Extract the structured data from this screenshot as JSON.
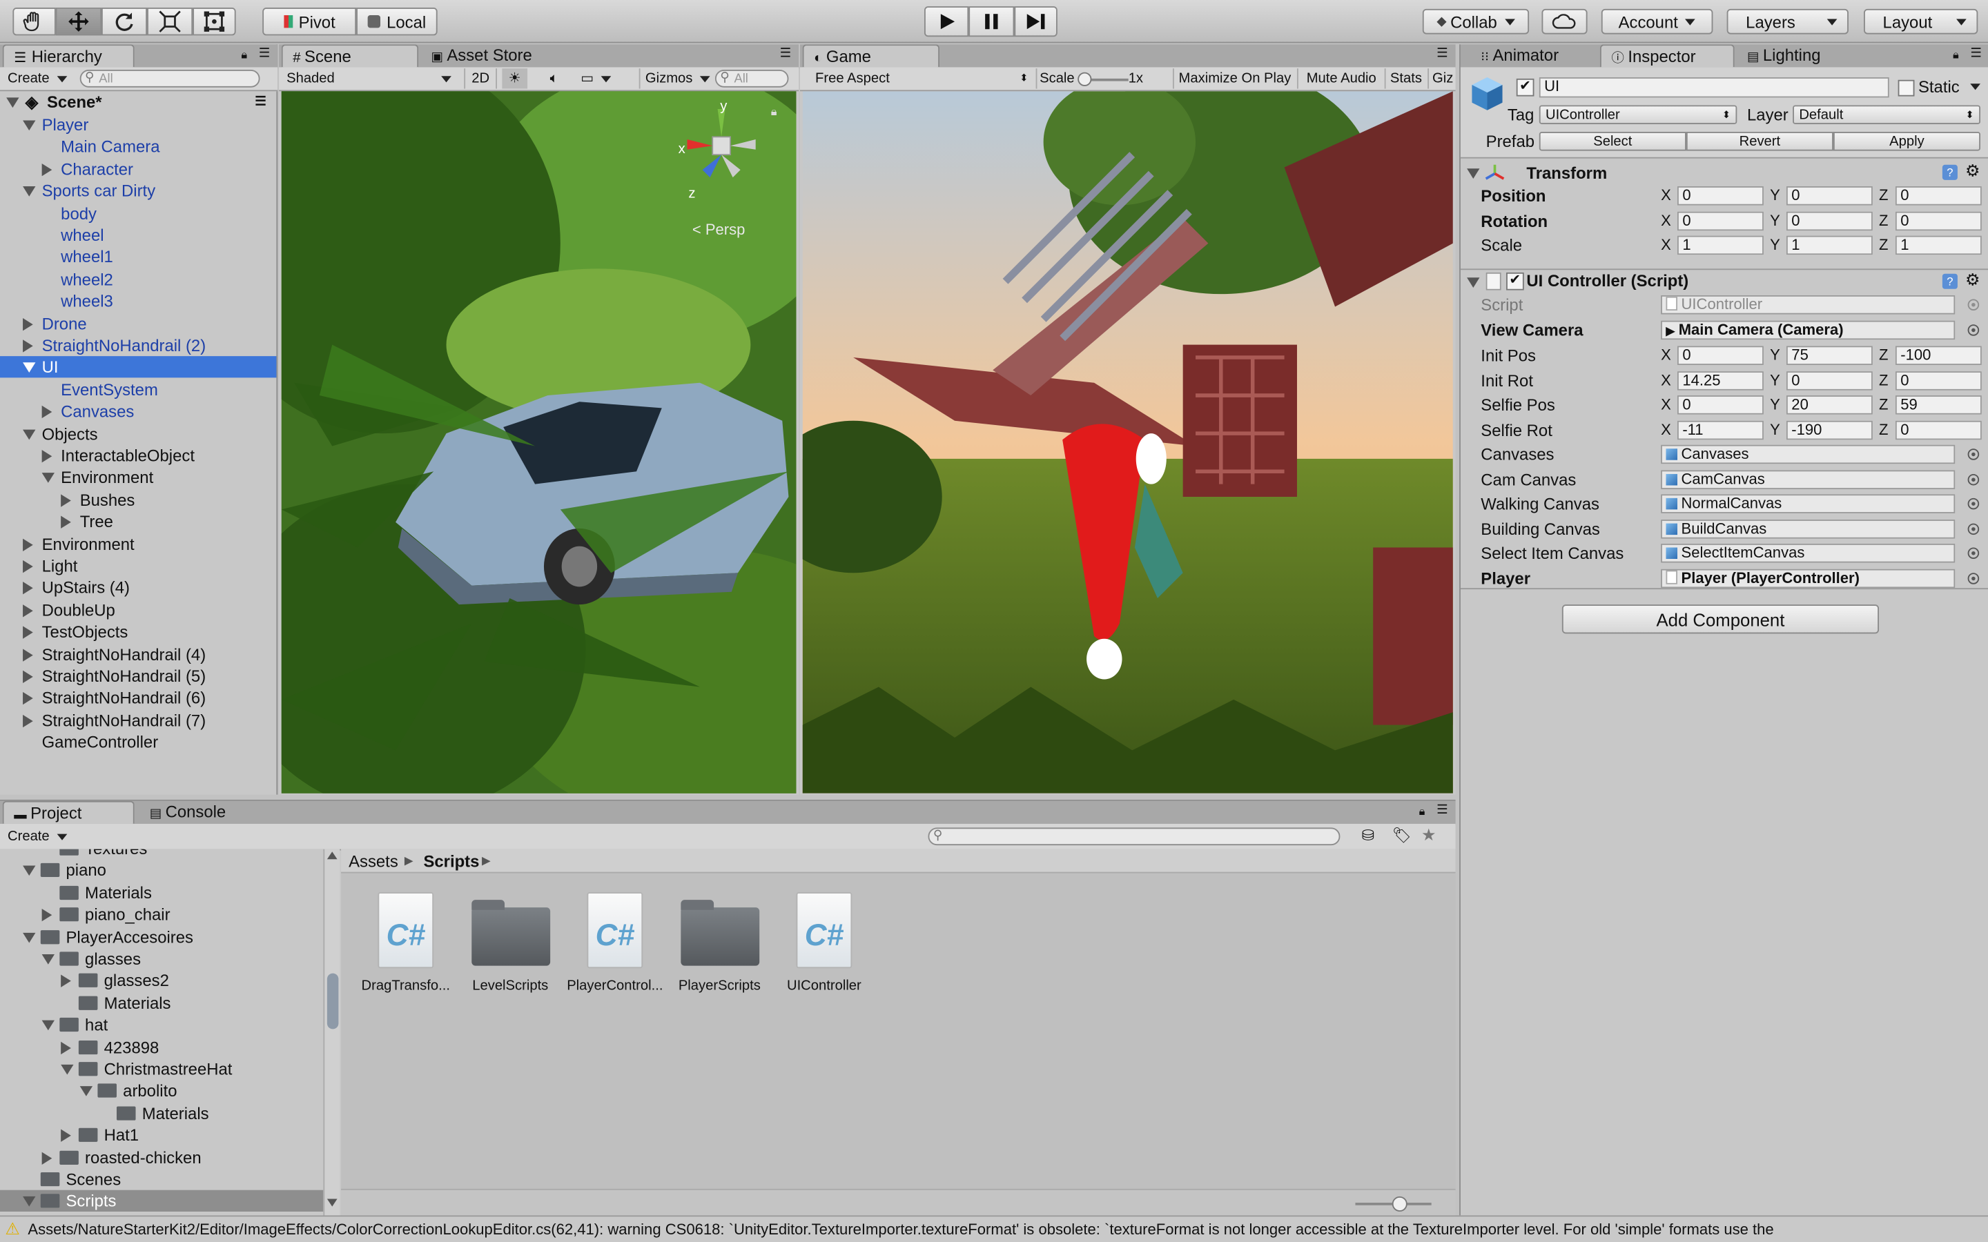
{
  "toolbar": {
    "pivot": "Pivot",
    "local": "Local",
    "collab": "Collab",
    "account": "Account",
    "layers": "Layers",
    "layout": "Layout"
  },
  "hierarchy": {
    "tab": "Hierarchy",
    "create": "Create",
    "search_placeholder": "All",
    "scene": "Scene*",
    "items": [
      {
        "label": "Player",
        "depth": 1,
        "expand": "open",
        "style": "blue"
      },
      {
        "label": "Main Camera",
        "depth": 2,
        "expand": "none",
        "style": "blue"
      },
      {
        "label": "Character",
        "depth": 2,
        "expand": "closed",
        "style": "blue"
      },
      {
        "label": "Sports car Dirty",
        "depth": 1,
        "expand": "open",
        "style": "blue"
      },
      {
        "label": "body",
        "depth": 2,
        "expand": "none",
        "style": "blue"
      },
      {
        "label": "wheel",
        "depth": 2,
        "expand": "none",
        "style": "blue"
      },
      {
        "label": "wheel1",
        "depth": 2,
        "expand": "none",
        "style": "blue"
      },
      {
        "label": "wheel2",
        "depth": 2,
        "expand": "none",
        "style": "blue"
      },
      {
        "label": "wheel3",
        "depth": 2,
        "expand": "none",
        "style": "blue"
      },
      {
        "label": "Drone",
        "depth": 1,
        "expand": "closed",
        "style": "blue"
      },
      {
        "label": "StraightNoHandrail (2)",
        "depth": 1,
        "expand": "closed",
        "style": "blue"
      },
      {
        "label": "UI",
        "depth": 1,
        "expand": "open",
        "style": "sel"
      },
      {
        "label": "EventSystem",
        "depth": 2,
        "expand": "none",
        "style": "blue"
      },
      {
        "label": "Canvases",
        "depth": 2,
        "expand": "closed",
        "style": "blue"
      },
      {
        "label": "Objects",
        "depth": 1,
        "expand": "open",
        "style": "plain"
      },
      {
        "label": "InteractableObject",
        "depth": 2,
        "expand": "closed",
        "style": "plain"
      },
      {
        "label": "Environment",
        "depth": 2,
        "expand": "open",
        "style": "plain"
      },
      {
        "label": "Bushes",
        "depth": 3,
        "expand": "closed",
        "style": "plain"
      },
      {
        "label": "Tree",
        "depth": 3,
        "expand": "closed",
        "style": "plain"
      },
      {
        "label": "Environment",
        "depth": 1,
        "expand": "closed",
        "style": "plain"
      },
      {
        "label": "Light",
        "depth": 1,
        "expand": "closed",
        "style": "plain"
      },
      {
        "label": "UpStairs (4)",
        "depth": 1,
        "expand": "closed",
        "style": "plain"
      },
      {
        "label": "DoubleUp",
        "depth": 1,
        "expand": "closed",
        "style": "plain"
      },
      {
        "label": "TestObjects",
        "depth": 1,
        "expand": "closed",
        "style": "plain"
      },
      {
        "label": "StraightNoHandrail (4)",
        "depth": 1,
        "expand": "closed",
        "style": "plain"
      },
      {
        "label": "StraightNoHandrail (5)",
        "depth": 1,
        "expand": "closed",
        "style": "plain"
      },
      {
        "label": "StraightNoHandrail (6)",
        "depth": 1,
        "expand": "closed",
        "style": "plain"
      },
      {
        "label": "StraightNoHandrail (7)",
        "depth": 1,
        "expand": "closed",
        "style": "plain"
      },
      {
        "label": "GameController",
        "depth": 1,
        "expand": "none",
        "style": "plain"
      }
    ]
  },
  "scene_view": {
    "tab": "Scene",
    "asset_store_tab": "Asset Store",
    "shading": "Shaded",
    "mode_2d": "2D",
    "gizmos": "Gizmos",
    "search_placeholder": "All",
    "persp": "< Persp",
    "axis_x": "x",
    "axis_y": "y",
    "axis_z": "z"
  },
  "game_view": {
    "tab": "Game",
    "aspect": "Free Aspect",
    "scale_label": "Scale",
    "scale_value": "1x",
    "maximize": "Maximize On Play",
    "mute": "Mute Audio",
    "stats": "Stats",
    "gizmos": "Giz"
  },
  "inspector": {
    "tabs": [
      "Animator",
      "Inspector",
      "Lighting"
    ],
    "object_name": "UI",
    "static": "Static",
    "tag_label": "Tag",
    "tag_value": "UIController",
    "layer_label": "Layer",
    "layer_value": "Default",
    "prefab_label": "Prefab",
    "prefab_buttons": [
      "Select",
      "Revert",
      "Apply"
    ],
    "transform": {
      "title": "Transform",
      "rows": [
        {
          "label": "Position",
          "bold": true,
          "x": "0",
          "y": "0",
          "z": "0"
        },
        {
          "label": "Rotation",
          "bold": true,
          "x": "0",
          "y": "0",
          "z": "0"
        },
        {
          "label": "Scale",
          "bold": false,
          "x": "1",
          "y": "1",
          "z": "1"
        }
      ]
    },
    "script_component": {
      "title": "UI Controller (Script)",
      "script_label": "Script",
      "script_value": "UIController",
      "view_camera_label": "View Camera",
      "view_camera_value": "Main Camera (Camera)",
      "vectors": [
        {
          "label": "Init Pos",
          "x": "0",
          "y": "75",
          "z": "-100"
        },
        {
          "label": "Init Rot",
          "x": "14.25",
          "y": "0",
          "z": "0"
        },
        {
          "label": "Selfie Pos",
          "x": "0",
          "y": "20",
          "z": "59"
        },
        {
          "label": "Selfie Rot",
          "x": "-11",
          "y": "-190",
          "z": "0"
        }
      ],
      "refs": [
        {
          "label": "Canvases",
          "value": "Canvases"
        },
        {
          "label": "Cam Canvas",
          "value": "CamCanvas"
        },
        {
          "label": "Walking Canvas",
          "value": "NormalCanvas"
        },
        {
          "label": "Building Canvas",
          "value": "BuildCanvas"
        },
        {
          "label": "Select Item Canvas",
          "value": "SelectItemCanvas"
        }
      ],
      "player_label": "Player",
      "player_value": "Player (PlayerController)"
    },
    "add_component": "Add Component"
  },
  "project": {
    "tab": "Project",
    "console_tab": "Console",
    "create": "Create",
    "tree": [
      {
        "label": "Textures",
        "depth": 2,
        "expand": "none"
      },
      {
        "label": "piano",
        "depth": 1,
        "expand": "open"
      },
      {
        "label": "Materials",
        "depth": 2,
        "expand": "none"
      },
      {
        "label": "piano_chair",
        "depth": 2,
        "expand": "closed"
      },
      {
        "label": "PlayerAccesoires",
        "depth": 1,
        "expand": "open"
      },
      {
        "label": "glasses",
        "depth": 2,
        "expand": "open"
      },
      {
        "label": "glasses2",
        "depth": 3,
        "expand": "closed"
      },
      {
        "label": "Materials",
        "depth": 3,
        "expand": "none"
      },
      {
        "label": "hat",
        "depth": 2,
        "expand": "open"
      },
      {
        "label": "423898",
        "depth": 3,
        "expand": "closed"
      },
      {
        "label": "ChristmastreeHat",
        "depth": 3,
        "expand": "open"
      },
      {
        "label": "arbolito",
        "depth": 4,
        "expand": "open"
      },
      {
        "label": "Materials",
        "depth": 5,
        "expand": "none"
      },
      {
        "label": "Hat1",
        "depth": 3,
        "expand": "closed"
      },
      {
        "label": "roasted-chicken",
        "depth": 2,
        "expand": "closed"
      },
      {
        "label": "Scenes",
        "depth": 1,
        "expand": "none"
      },
      {
        "label": "Scripts",
        "depth": 1,
        "expand": "open"
      }
    ],
    "breadcrumb": [
      "Assets",
      "Scripts"
    ],
    "assets": [
      {
        "name": "DragTransfo...",
        "kind": "cs"
      },
      {
        "name": "LevelScripts",
        "kind": "folder"
      },
      {
        "name": "PlayerControl...",
        "kind": "cs"
      },
      {
        "name": "PlayerScripts",
        "kind": "folder"
      },
      {
        "name": "UIController",
        "kind": "cs"
      }
    ],
    "cs_glyph": "C#"
  },
  "status": {
    "message": "Assets/NatureStarterKit2/Editor/ImageEffects/ColorCorrectionLookupEditor.cs(62,41): warning CS0618: `UnityEditor.TextureImporter.textureFormat' is obsolete: `textureFormat is not longer accessible at the TextureImporter level. For old 'simple' formats use the"
  }
}
